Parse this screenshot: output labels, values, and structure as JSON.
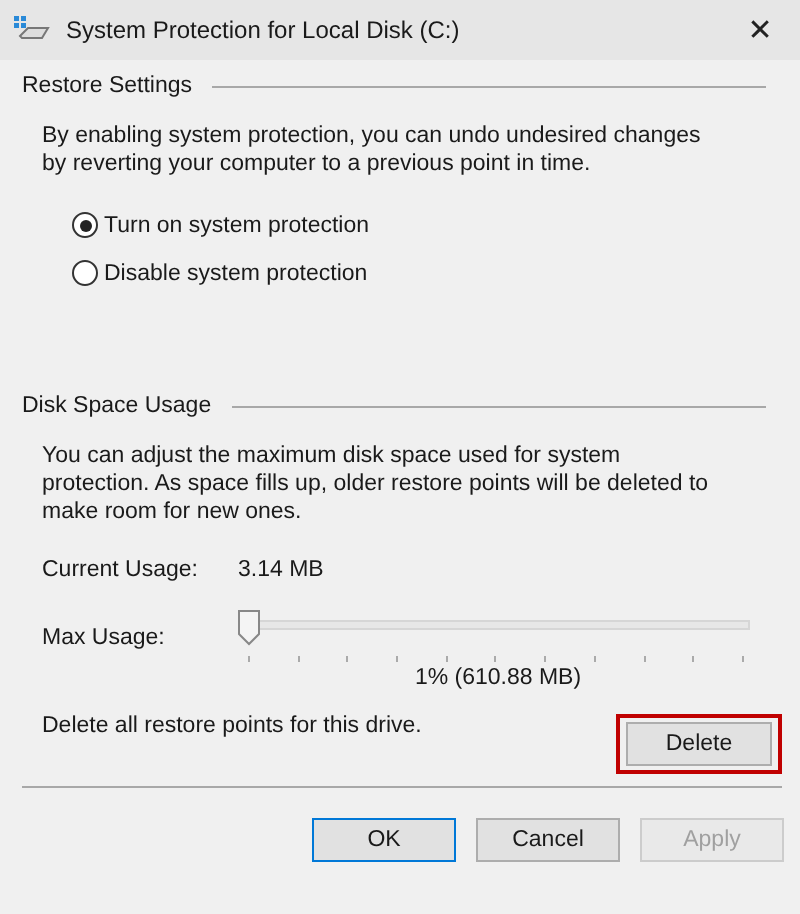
{
  "window": {
    "title": "System Protection for Local Disk (C:)",
    "close": "✕"
  },
  "restore_settings": {
    "heading": "Restore Settings",
    "description": "By enabling system protection, you can undo undesired changes by reverting your computer to a previous point in time.",
    "options": [
      {
        "label": "Turn on system protection",
        "selected": true
      },
      {
        "label": "Disable system protection",
        "selected": false
      }
    ]
  },
  "disk_space_usage": {
    "heading": "Disk Space Usage",
    "description": "You can adjust the maximum disk space used for system protection. As space fills up, older restore points will be deleted to make room for new ones.",
    "current_usage_label": "Current Usage:",
    "current_usage": "3.14 MB",
    "max_usage_label": "Max Usage:",
    "max_usage": {
      "level": 0.0
    },
    "max_usage_reading": "1% (610.88 MB)",
    "delete_text": "Delete all restore points for this drive.",
    "delete_button": {
      "label": "Delete",
      "highlighted": true
    }
  },
  "buttons": [
    {
      "label": "OK",
      "default": true,
      "disabled": false
    },
    {
      "label": "Cancel",
      "default": false,
      "disabled": false
    },
    {
      "label": "Apply",
      "default": false,
      "disabled": true
    }
  ]
}
